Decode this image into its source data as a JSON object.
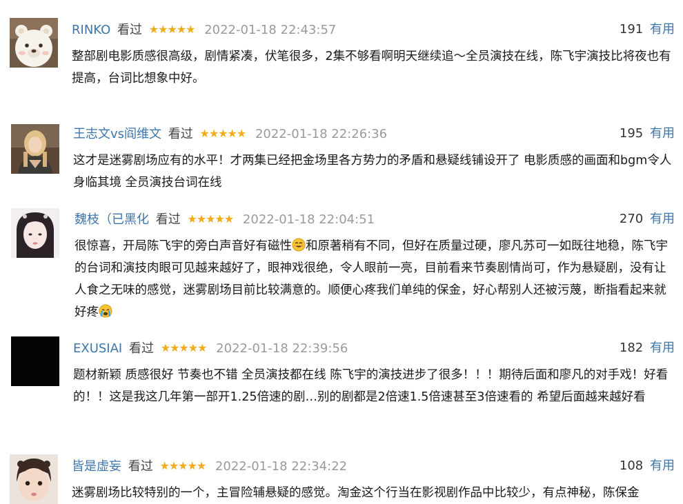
{
  "comments": [
    {
      "user": "RINKO",
      "status": "看过",
      "stars": "★★★★★",
      "time": "2022-01-18 22:43:57",
      "votes": "191",
      "useful": "有用",
      "text": "整部剧电影质感很高级，剧情紧凑，伏笔很多，2集不够看啊明天继续追～全员演技在线，陈飞宇演技比将夜也有提高，台词比想象中好。"
    },
    {
      "user": "王志文vs阎维文",
      "status": "看过",
      "stars": "★★★★★",
      "time": "2022-01-18 22:26:36",
      "votes": "195",
      "useful": "有用",
      "text": "这才是迷雾剧场应有的水平！才两集已经把金场里各方势力的矛盾和悬疑线铺设开了 电影质感的画面和bgm令人身临其境 全员演技台词在线"
    },
    {
      "user": "魏枝（已黑化",
      "status": "看过",
      "stars": "★★★★★",
      "time": "2022-01-18 22:04:51",
      "votes": "270",
      "useful": "有用",
      "text_a": "很惊喜，开局陈飞宇的旁白声音好有磁性",
      "text_b": "和原著稍有不同，但好在质量过硬，廖凡苏可一如既往地稳，陈飞宇的台词和演技肉眼可见越来越好了，眼神戏很绝，令人眼前一亮，目前看来节奏剧情尚可，作为悬疑剧，没有让人食之无味的感觉，迷雾剧场目前比较满意的。顺便心疼我们单纯的保金，好心帮别人还被污蔑，断指看起来就好疼",
      "emoji_1": "smiling-face-emoji",
      "emoji_2": "crying-face-emoji"
    },
    {
      "user": "EXUSIAI",
      "status": "看过",
      "stars": "★★★★★",
      "time": "2022-01-18 22:39:56",
      "votes": "182",
      "useful": "有用",
      "text": "题材新颖 质感很好 节奏也不错 全员演技都在线 陈飞宇的演技进步了很多！！！期待后面和廖凡的对手戏！好看的！！这是我这几年第一部开1.25倍速的剧…别的剧都是2倍速1.5倍速甚至3倍速看的 希望后面越来越好看"
    },
    {
      "user": "皆是虚妄",
      "status": "看过",
      "stars": "★★★★★",
      "time": "2022-01-18 22:34:22",
      "votes": "108",
      "useful": "有用",
      "text": "迷雾剧场比较特别的一个，主冒险辅悬疑的感觉。淘金这个行当在影视剧作品中比较少，有点神秘，陈保金"
    }
  ],
  "colors": {
    "link": "#3d76ad",
    "star": "#f2ab1b",
    "time": "#9a9a9a"
  }
}
